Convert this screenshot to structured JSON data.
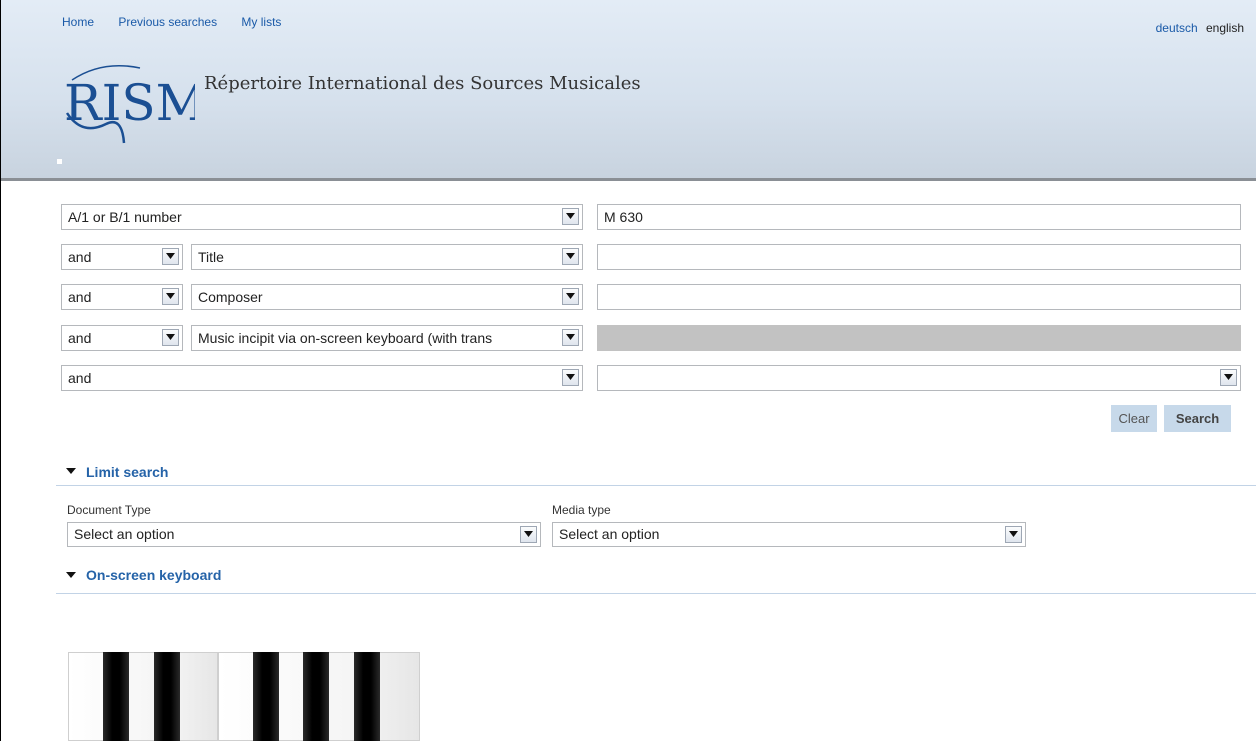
{
  "nav": {
    "home": "Home",
    "previous_searches": "Previous searches",
    "my_lists": "My lists"
  },
  "lang": {
    "deutsch": "deutsch",
    "english": "english"
  },
  "site": {
    "logo_text": "RISM",
    "title": "Répertoire International des Sources Musicales"
  },
  "query": {
    "rows": [
      {
        "operator": "",
        "field": "A/1 or B/1 number",
        "value": "M 630"
      },
      {
        "operator": "and",
        "field": "Title",
        "value": ""
      },
      {
        "operator": "and",
        "field": "Composer",
        "value": ""
      },
      {
        "operator": "and",
        "field": "Music incipit via on-screen keyboard (with trans",
        "value": "",
        "disabled": true
      },
      {
        "operator": "and",
        "field": "",
        "value": ""
      }
    ]
  },
  "buttons": {
    "clear": "Clear",
    "search": "Search"
  },
  "limit": {
    "heading": "Limit search",
    "document_type_label": "Document Type",
    "document_type_value": "Select an option",
    "media_type_label": "Media type",
    "media_type_value": "Select an option"
  },
  "keyboard": {
    "heading": "On-screen keyboard"
  },
  "icons": {
    "dropdown": "chevron-down-icon",
    "section": "triangle-down-icon"
  },
  "colors": {
    "link": "#1a5aa8",
    "section_heading": "#2563a8",
    "button_bg": "#c7d9ea",
    "logo": "#1b4f93"
  }
}
